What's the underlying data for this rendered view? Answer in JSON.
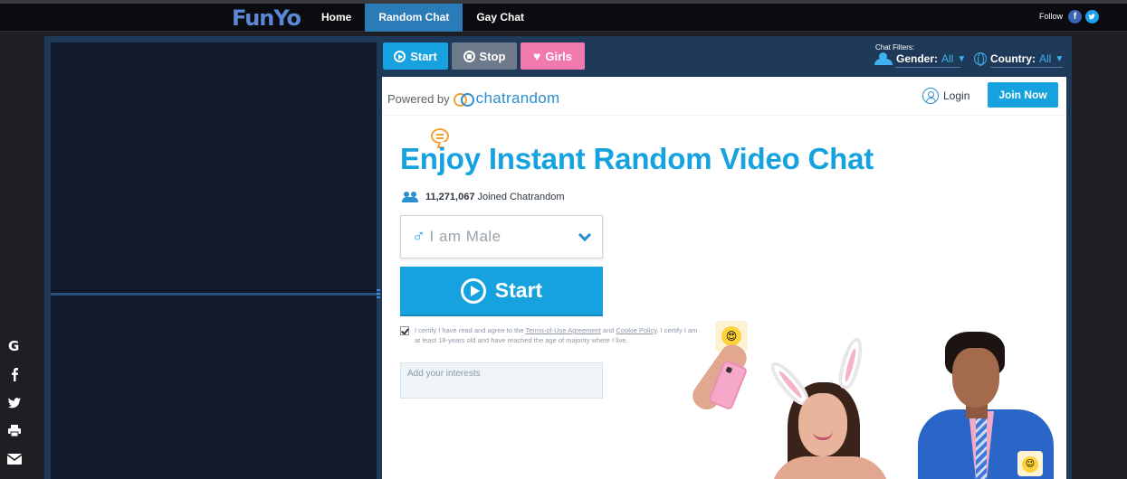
{
  "header": {
    "logo": "FunYo",
    "nav": [
      {
        "label": "Home",
        "active": false
      },
      {
        "label": "Random Chat",
        "active": true
      },
      {
        "label": "Gay Chat",
        "active": false
      }
    ],
    "follow_label": "Follow",
    "social": [
      "facebook-icon",
      "twitter-icon"
    ]
  },
  "sidebar_share": [
    "google-icon",
    "facebook-icon",
    "twitter-icon",
    "print-icon",
    "mail-icon"
  ],
  "toolbar": {
    "start_label": "Start",
    "stop_label": "Stop",
    "girls_label": "Girls",
    "filters_label": "Chat Filters:",
    "gender_label": "Gender:",
    "gender_value": "All",
    "country_label": "Country:",
    "country_value": "All"
  },
  "panel": {
    "powered_by": "Powered by",
    "brand": "chatrandom",
    "login_label": "Login",
    "join_label": "Join Now",
    "headline": "Enjoy Instant Random Video Chat",
    "joined_count": "11,271,067",
    "joined_text": "Joined Chatrandom",
    "gender_select": "I am Male",
    "start_label": "Start",
    "certify_before": "I certify I have read and agree to the",
    "terms_link": "Terms-of-Use Agreement",
    "and": "and",
    "cookie_link": "Cookie Policy",
    "certify_after": ". I certify I am at least 18-years old and have reached the age of majority where I live.",
    "interests_placeholder": "Add your interests"
  },
  "colors": {
    "accent": "#16a2df",
    "girls": "#f179ae",
    "stop": "#6d7a8b",
    "nav_active": "#2a7cb8"
  }
}
